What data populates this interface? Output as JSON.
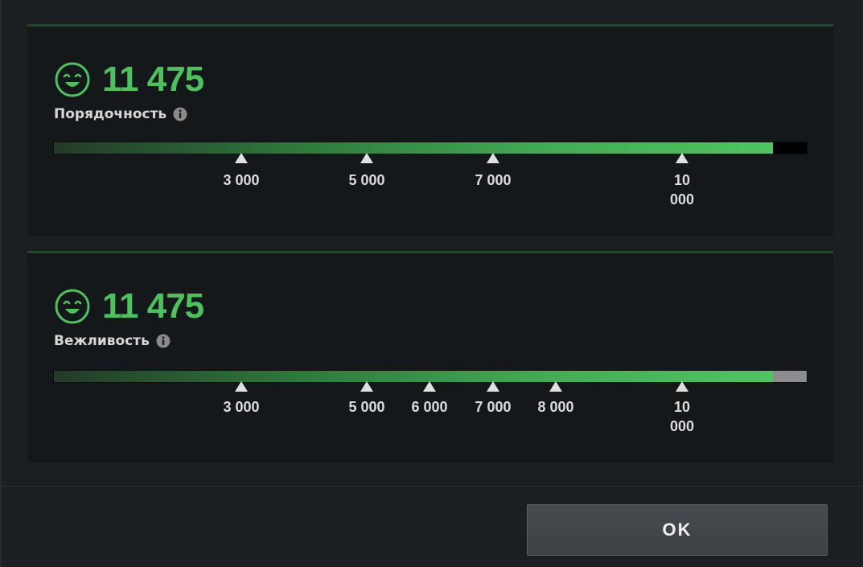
{
  "colors": {
    "score_green": "#4cc25c",
    "panel_bg": "#14181a",
    "page_bg": "#1b1f22",
    "bar_rest_1": "#000000",
    "bar_rest_2": "#8c8c8c"
  },
  "panels": [
    {
      "score": "11 475",
      "label": "Порядочность",
      "icon": "smiley-icon",
      "progress_fraction": 0.955,
      "rest_color": "#000000",
      "markers": [
        {
          "value": 3000,
          "label": "3 000"
        },
        {
          "value": 5000,
          "label": "5 000"
        },
        {
          "value": 7000,
          "label": "7 000"
        },
        {
          "value": 10000,
          "label": "10 000"
        }
      ]
    },
    {
      "score": "11 475",
      "label": "Вежливость",
      "icon": "smiley-icon",
      "progress_fraction": 0.955,
      "rest_color": "#8c8c8c",
      "markers": [
        {
          "value": 3000,
          "label": "3 000"
        },
        {
          "value": 5000,
          "label": "5 000"
        },
        {
          "value": 6000,
          "label": "6 000"
        },
        {
          "value": 7000,
          "label": "7 000"
        },
        {
          "value": 8000,
          "label": "8 000"
        },
        {
          "value": 10000,
          "label": "10 000"
        }
      ]
    }
  ],
  "ok_button": {
    "label": "OK"
  }
}
